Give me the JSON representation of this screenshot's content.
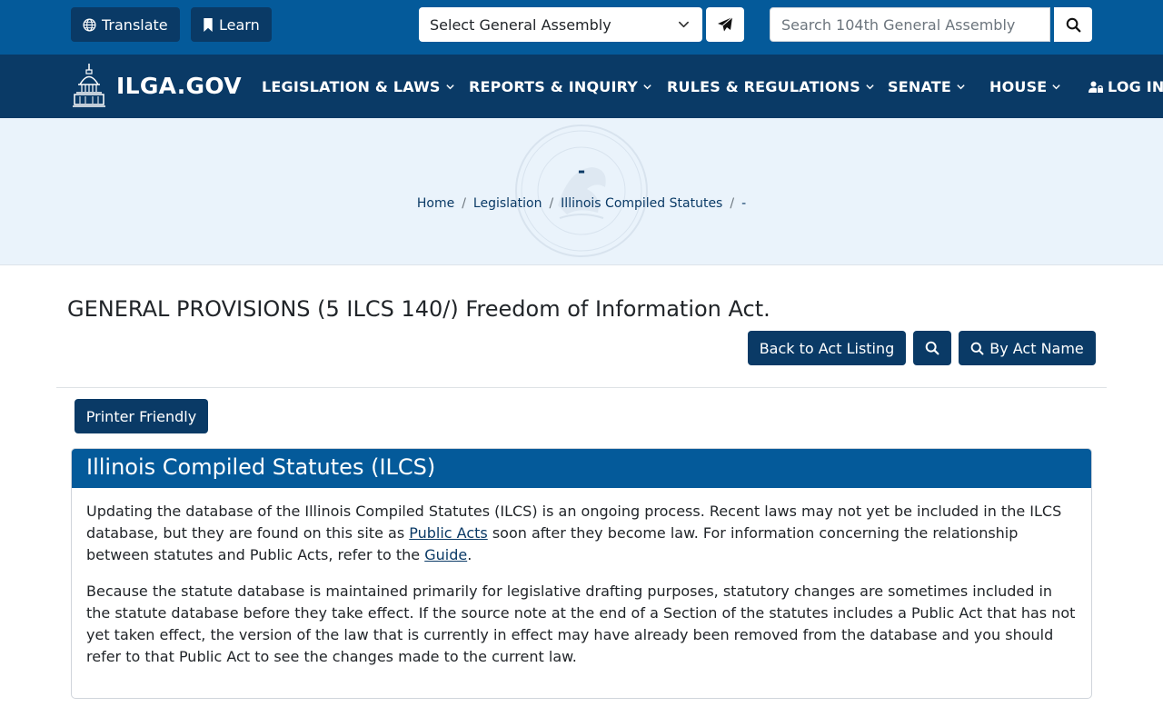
{
  "utility": {
    "translate_label": "Translate",
    "learn_label": "Learn",
    "assembly_select_value": "Select General Assembly",
    "search_placeholder": "Search 104th General Assembly"
  },
  "nav": {
    "logo_text": "ILGA.GOV",
    "items": [
      {
        "label": "LEGISLATION & LAWS"
      },
      {
        "label": "REPORTS & INQUIRY"
      },
      {
        "label": "RULES & REGULATIONS"
      },
      {
        "label": "SENATE"
      },
      {
        "label": "HOUSE"
      }
    ],
    "login_label": "LOG IN"
  },
  "hero": {
    "title": "-",
    "breadcrumb": [
      "Home",
      "Legislation",
      "Illinois Compiled Statutes",
      "-"
    ]
  },
  "content": {
    "act_title": "GENERAL PROVISIONS (5 ILCS 140/) Freedom of Information Act.",
    "back_label": "Back to Act Listing",
    "by_act_name_label": "By Act Name",
    "printer_friendly_label": "Printer Friendly"
  },
  "card": {
    "title": "Illinois Compiled Statutes (ILCS)",
    "p1_before": "Updating the database of the Illinois Compiled Statutes (ILCS) is an ongoing process. Recent laws may not yet be included in the ILCS database, but they are found on this site as ",
    "p1_link1": "Public Acts",
    "p1_middle": " soon after they become law. For information concerning the relationship between statutes and Public Acts, refer to the ",
    "p1_link2": "Guide",
    "p1_end": ".",
    "p2": "Because the statute database is maintained primarily for legislative drafting purposes, statutory changes are sometimes included in the statute database before they take effect. If the source note at the end of a Section of the statutes includes a Public Act that has not yet taken effect, the version of the law that is currently in effect may have already been removed from the database and you should refer to that Public Act to see the changes made to the current law."
  },
  "colors": {
    "utility_bg": "#045a9a",
    "nav_bg": "#0a3a66",
    "hero_bg": "#eaf3fb",
    "button_bg": "#0a3a66"
  }
}
